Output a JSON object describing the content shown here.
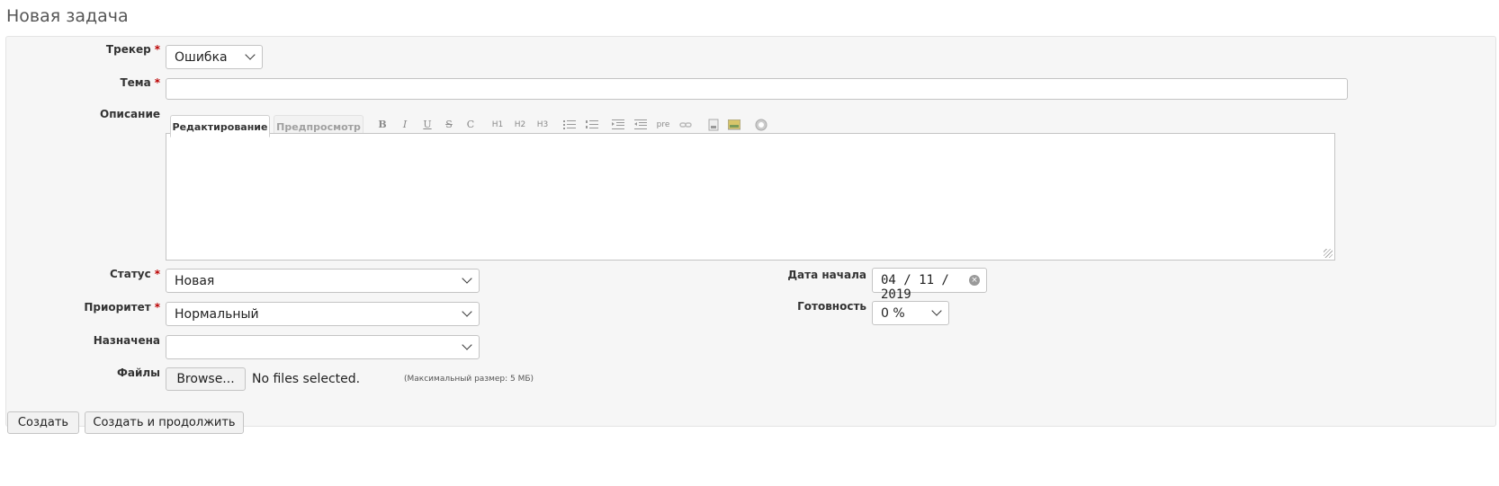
{
  "page": {
    "title": "Новая задача"
  },
  "form": {
    "tracker": {
      "label": "Трекер",
      "required": "*",
      "value": "Ошибка"
    },
    "subject": {
      "label": "Тема",
      "required": "*",
      "value": ""
    },
    "description": {
      "label": "Описание",
      "tab_edit": "Редактирование",
      "tab_preview": "Предпросмотр",
      "toolbar": {
        "bold": "B",
        "italic": "I",
        "underline": "U",
        "strike": "S",
        "code": "C",
        "h1": "H1",
        "h2": "H2",
        "h3": "H3",
        "pre": "pre"
      },
      "icons": [
        "bold-icon",
        "italic-icon",
        "underline-icon",
        "strike-icon",
        "code-icon",
        "h1-icon",
        "h2-icon",
        "h3-icon",
        "bullet-list-icon",
        "numbered-list-icon",
        "indent-right-icon",
        "indent-left-icon",
        "pre-icon",
        "link-icon",
        "wiki-page-icon",
        "image-icon",
        "help-icon"
      ]
    },
    "status": {
      "label": "Статус",
      "required": "*",
      "value": "Новая"
    },
    "priority": {
      "label": "Приоритет",
      "required": "*",
      "value": "Нормальный"
    },
    "assignee": {
      "label": "Назначена",
      "value": ""
    },
    "files": {
      "label": "Файлы",
      "browse": "Browse...",
      "status": "No files selected.",
      "max_size": "(Максимальный размер: 5 МБ)"
    },
    "start_date": {
      "label": "Дата начала",
      "value": "04 / 11 / 2019"
    },
    "done_ratio": {
      "label": "Готовность",
      "value": "0 %"
    }
  },
  "actions": {
    "create": "Создать",
    "create_continue": "Создать и продолжить"
  }
}
